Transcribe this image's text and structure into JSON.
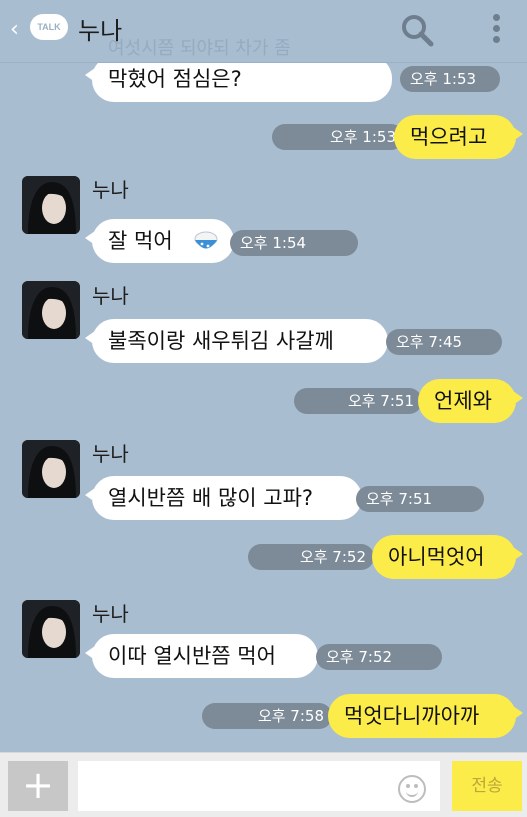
{
  "header": {
    "back": "‹",
    "talk_badge": "TALK",
    "title": "누나",
    "banner": "여섯시쯤 되야되 차가 좀"
  },
  "messages": [
    {
      "text": "막혔어 점심은?",
      "time": "오후 1:53"
    },
    {
      "text": "먹으려고",
      "time": "오후 1:53"
    },
    {
      "sender": "누나",
      "text": "잘 먹어",
      "time": "오후 1:54"
    },
    {
      "sender": "누나",
      "text": "불족이랑 새우튀김 사갈께",
      "time": "오후 7:45"
    },
    {
      "text": "언제와",
      "time": "오후 7:51"
    },
    {
      "sender": "누나",
      "text": "열시반쯤 배 많이 고파?",
      "time": "오후 7:51"
    },
    {
      "text": "아니먹엇어",
      "time": "오후 7:52"
    },
    {
      "sender": "누나",
      "text": "이따 열시반쯤 먹어",
      "time": "오후 7:52"
    },
    {
      "text": "먹엇다니까아까",
      "time": "오후 7:58"
    }
  ],
  "bottom": {
    "plus": "+",
    "send_label": "전송"
  }
}
